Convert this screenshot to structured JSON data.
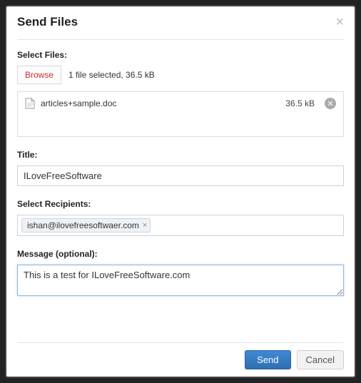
{
  "dialog": {
    "title": "Send Files",
    "selectFilesLabel": "Select Files:",
    "browseLabel": "Browse",
    "fileStatus": "1 file selected, 36.5 kB",
    "files": [
      {
        "name": "articles+sample.doc",
        "size": "36.5 kB"
      }
    ],
    "titleFieldLabel": "Title:",
    "titleValue": "ILoveFreeSoftware",
    "recipientsLabel": "Select Recipients:",
    "recipients": [
      {
        "email": "ishan@ilovefreesoftwaer.com"
      }
    ],
    "messageLabel": "Message (optional):",
    "messageValue": "This is a test for ILoveFreeSoftware.com",
    "sendLabel": "Send",
    "cancelLabel": "Cancel"
  }
}
